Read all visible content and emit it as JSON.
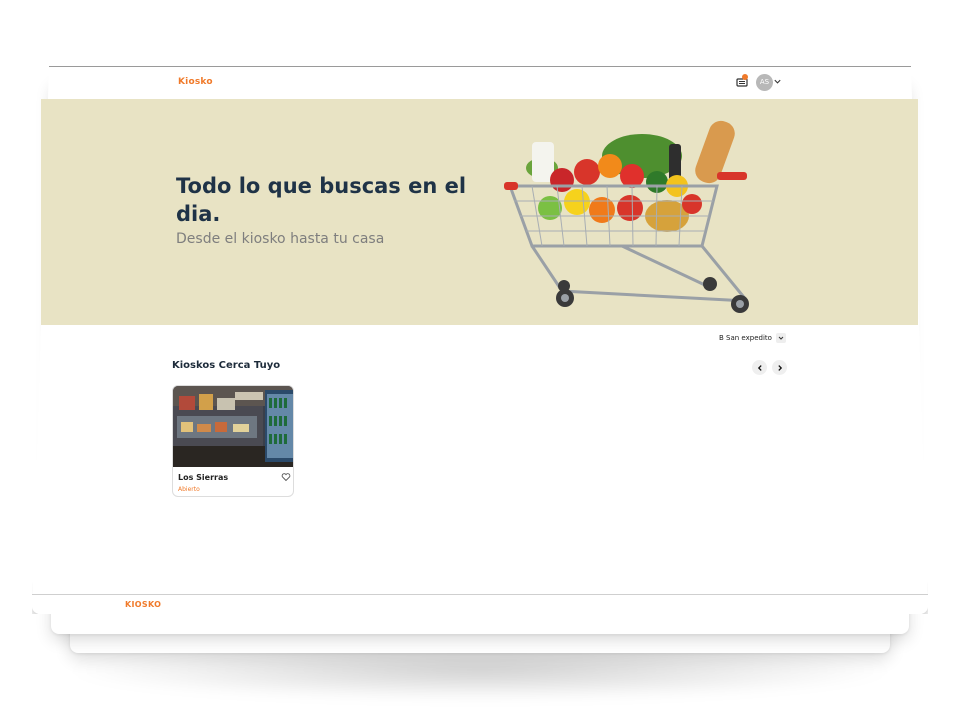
{
  "header": {
    "brand": "Kiosko",
    "avatar_initials": "AS",
    "cart_icon": "cart-icon",
    "notification_color": "#f07a2a"
  },
  "hero": {
    "title": "Todo lo que buscas en el dia.",
    "subtitle": "Desde el kiosko hasta tu casa",
    "background_color": "#e8e3c4",
    "image": "shopping-cart-with-groceries"
  },
  "location": {
    "selected": "B San expedito"
  },
  "nearby": {
    "title": "Kioskos Cerca Tuyo",
    "stores": [
      {
        "name": "Los Sierras",
        "status": "Abierto",
        "favorite_icon": "heart-icon"
      }
    ]
  },
  "footer": {
    "brand": "KIOSKO"
  },
  "colors": {
    "accent": "#f07a2a",
    "heading": "#1f3347"
  }
}
